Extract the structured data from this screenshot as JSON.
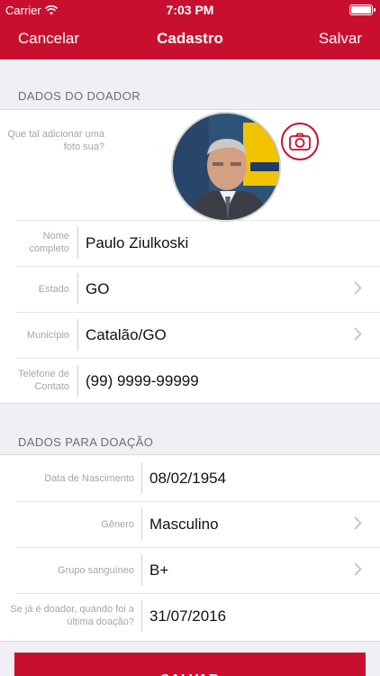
{
  "status_bar": {
    "carrier": "Carrier",
    "time": "7:03 PM"
  },
  "nav": {
    "cancel_label": "Cancelar",
    "title": "Cadastro",
    "save_label": "Salvar"
  },
  "donor_section": {
    "header": "DADOS DO DOADOR",
    "photo_prompt": "Que tal adicionar uma foto sua?",
    "fields": [
      {
        "label": "Nome completo",
        "value": "Paulo Ziulkoski"
      },
      {
        "label": "Estado",
        "value": "GO"
      },
      {
        "label": "Município",
        "value": "Catalão/GO"
      },
      {
        "label": "Telefone de Contato",
        "value": "(99) 9999-99999"
      }
    ]
  },
  "donation_section": {
    "header": "DADOS PARA DOAÇÃO",
    "fields": [
      {
        "label": "Data de Nascimento",
        "value": "08/02/1954"
      },
      {
        "label": "Gênero",
        "value": "Masculino"
      },
      {
        "label": "Grupo sanguíneo",
        "value": "B+"
      },
      {
        "label": "Se já é doador, quando foi a última doação?",
        "value": "31/07/2016"
      }
    ]
  },
  "save_button_label": "SALVAR",
  "colors": {
    "accent": "#c8102e",
    "background": "#efeff4",
    "label": "#a5a5aa"
  },
  "icons": [
    "wifi-icon",
    "battery-icon",
    "camera-icon",
    "chevron-right-icon"
  ]
}
